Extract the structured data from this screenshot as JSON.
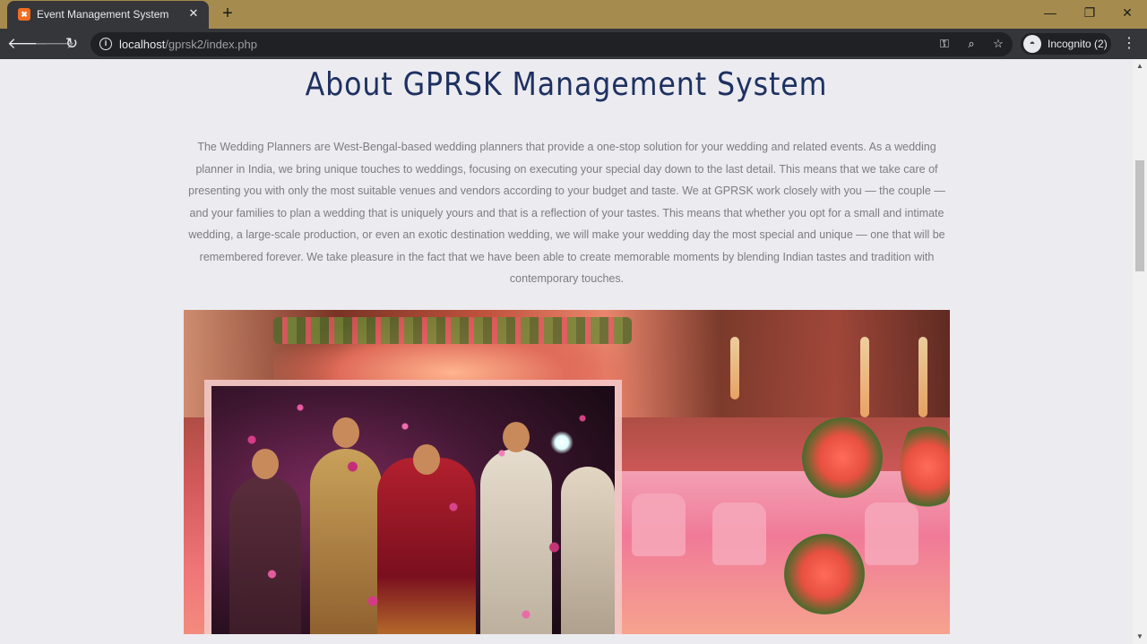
{
  "browser": {
    "tab_title": "Event Management System",
    "tab_close_glyph": "✕",
    "new_tab_glyph": "+",
    "window_controls": {
      "minimize": "—",
      "maximize": "❐",
      "close": "✕"
    },
    "url_host": "localhost",
    "url_path": "/gprsk2/index.php",
    "incognito_label": "Incognito (2)",
    "icons": {
      "back": "back-arrow-icon",
      "forward": "forward-arrow-icon",
      "reload": "reload-icon",
      "info": "info-icon",
      "key": "key-icon",
      "zoom": "zoom-icon",
      "bookmark": "star-icon",
      "menu": "kebab-menu-icon"
    },
    "theme_color": "#a58c4e"
  },
  "page": {
    "title": "About GPRSK Management System",
    "about_text": "The Wedding Planners are West-Bengal-based wedding planners that provide a one-stop solution for your wedding and related events. As a wedding planner in India, we bring unique touches to weddings, focusing on executing your special day down to the last detail. This means that we take care of presenting you with only the most suitable venues and vendors according to your budget and taste. We at GPRSK work closely with you — the couple — and your families to plan a wedding that is uniquely yours and that is a reflection of your tastes. This means that whether you opt for a small and intimate wedding, a large-scale production, or even an exotic destination wedding, we will make your wedding day the most special and unique — one that will be remembered forever. We take pleasure in the fact that we have been able to create memorable moments by blending Indian tastes and tradition with contemporary touches.",
    "title_color": "#1e3161",
    "text_color": "#7d7d80"
  }
}
